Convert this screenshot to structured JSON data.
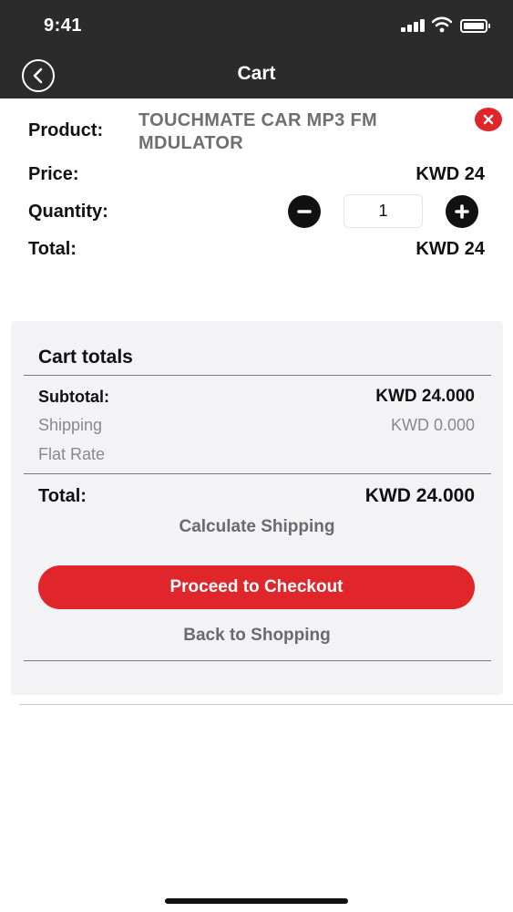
{
  "status_bar": {
    "time": "9:41",
    "icons": [
      "signal-icon",
      "wifi-icon",
      "battery-icon"
    ]
  },
  "nav": {
    "title": "Cart",
    "back_icon": "chevron-left-icon"
  },
  "cart_item": {
    "product_label": "Product:",
    "product_name": "TOUCHMATE CAR MP3 FM MDULATOR",
    "price_label": "Price:",
    "price_value": "KWD 24",
    "quantity_label": "Quantity:",
    "quantity_value": "1",
    "total_label": "Total:",
    "total_value": "KWD 24",
    "remove_icon": "close-icon"
  },
  "cart_totals": {
    "heading": "Cart totals",
    "subtotal_label": "Subtotal:",
    "subtotal_value": "KWD 24.000",
    "shipping_label": "Shipping",
    "shipping_value": "KWD 0.000",
    "shipping_method": "Flat Rate",
    "total_label": "Total:",
    "total_value": "KWD 24.000",
    "calculate_shipping": "Calculate Shipping",
    "checkout_label": "Proceed to Checkout",
    "back_label": "Back to Shopping"
  },
  "colors": {
    "header_bg": "#2b2b2b",
    "accent_red": "#e0262b",
    "panel_bg": "#f3f2f4"
  }
}
